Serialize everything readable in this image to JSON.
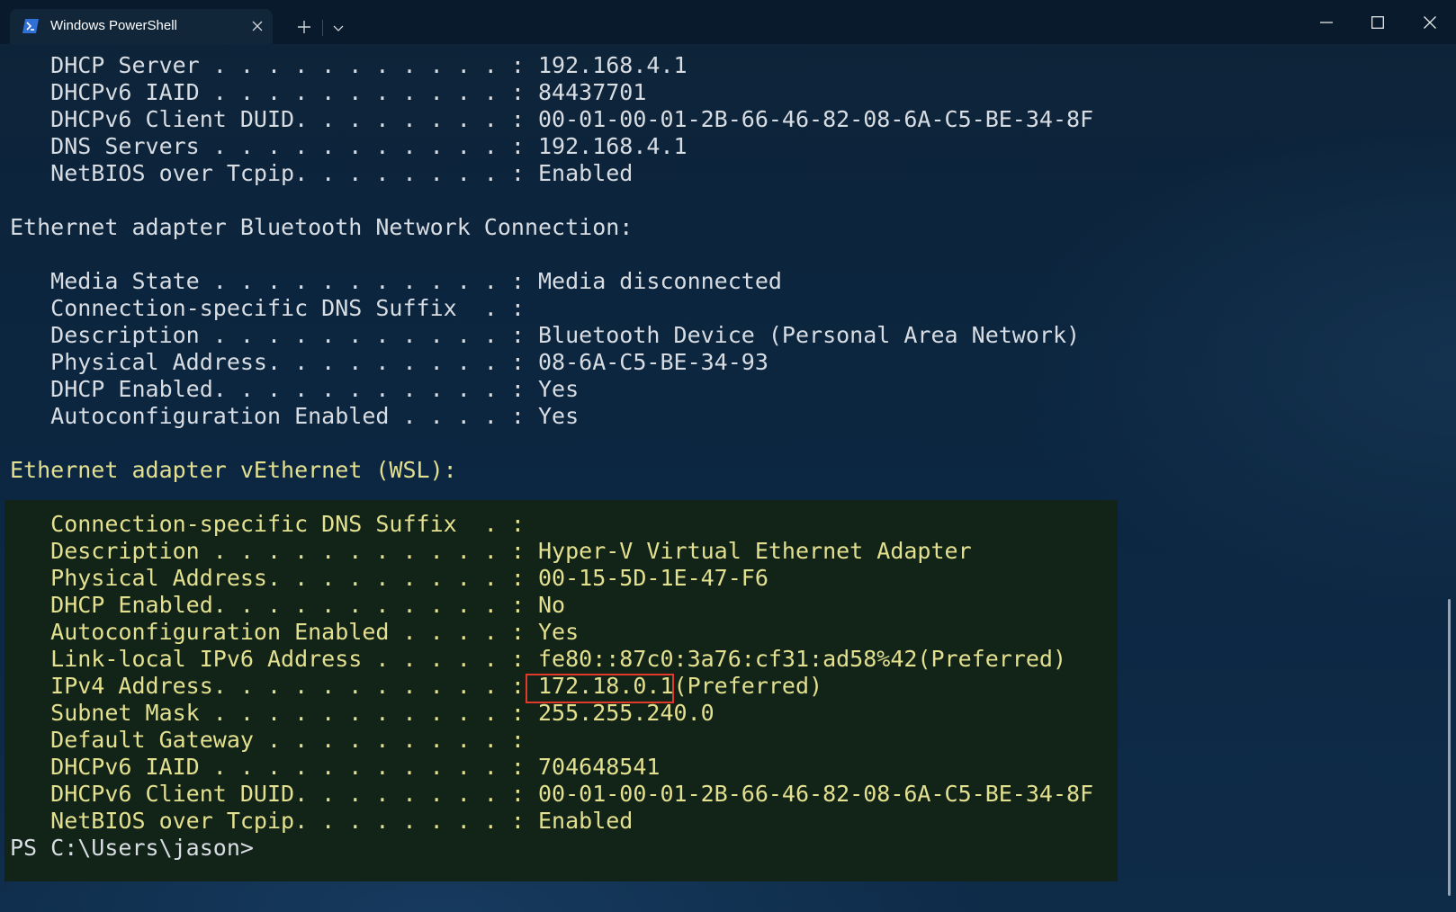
{
  "window": {
    "tab_title": "Windows PowerShell",
    "tab_icon": "powershell-icon",
    "new_tab_icon": "plus-icon",
    "dropdown_icon": "chevron-down-icon",
    "minimize_icon": "minimize-icon",
    "maximize_icon": "maximize-icon",
    "close_icon": "close-icon"
  },
  "colors": {
    "terminal_text": "#d8dde3",
    "highlighted_text": "#e3e08f",
    "highlight_background": "#122318",
    "annotation_box": "#e23a2a"
  },
  "terminal": {
    "lines": [
      "   DHCP Server . . . . . . . . . . . : 192.168.4.1",
      "   DHCPv6 IAID . . . . . . . . . . . : 84437701",
      "   DHCPv6 Client DUID. . . . . . . . : 00-01-00-01-2B-66-46-82-08-6A-C5-BE-34-8F",
      "   DNS Servers . . . . . . . . . . . : 192.168.4.1",
      "   NetBIOS over Tcpip. . . . . . . . : Enabled",
      "",
      "Ethernet adapter Bluetooth Network Connection:",
      "",
      "   Media State . . . . . . . . . . . : Media disconnected",
      "   Connection-specific DNS Suffix  . :",
      "   Description . . . . . . . . . . . : Bluetooth Device (Personal Area Network)",
      "   Physical Address. . . . . . . . . : 08-6A-C5-BE-34-93",
      "   DHCP Enabled. . . . . . . . . . . : Yes",
      "   Autoconfiguration Enabled . . . . : Yes",
      "",
      "Ethernet adapter vEthernet (WSL):",
      "",
      "   Connection-specific DNS Suffix  . :",
      "   Description . . . . . . . . . . . : Hyper-V Virtual Ethernet Adapter",
      "   Physical Address. . . . . . . . . : 00-15-5D-1E-47-F6",
      "   DHCP Enabled. . . . . . . . . . . : No",
      "   Autoconfiguration Enabled . . . . : Yes",
      "   Link-local IPv6 Address . . . . . : fe80::87c0:3a76:cf31:ad58%42(Preferred)",
      "   IPv4 Address. . . . . . . . . . . : 172.18.0.1(Preferred)",
      "   Subnet Mask . . . . . . . . . . . : 255.255.240.0",
      "   Default Gateway . . . . . . . . . :",
      "   DHCPv6 IAID . . . . . . . . . . . : 704648541",
      "   DHCPv6 Client DUID. . . . . . . . : 00-01-00-01-2B-66-46-82-08-6A-C5-BE-34-8F",
      "   NetBIOS over Tcpip. . . . . . . . : Enabled"
    ],
    "prompt": "PS C:\\Users\\jason>"
  }
}
